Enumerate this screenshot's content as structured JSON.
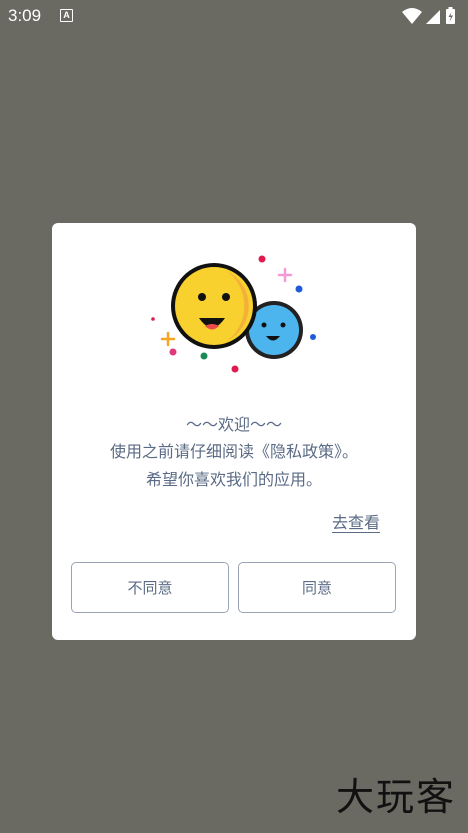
{
  "status_bar": {
    "time": "3:09",
    "notification_icon": "A",
    "icons": [
      "wifi-icon",
      "signal-icon",
      "battery-charging-icon"
    ]
  },
  "dialog": {
    "title": "～～欢迎～～",
    "line1": "使用之前请仔细阅读《隐私政策》。",
    "line2": "希望你喜欢我们的应用。",
    "view_link": "去查看",
    "disagree_label": "不同意",
    "agree_label": "同意"
  },
  "watermark": "大玩客",
  "colors": {
    "overlay": "#6a6a62",
    "dialog_bg": "#ffffff",
    "text": "#5b6b85",
    "button_border": "#9aa3b3"
  }
}
